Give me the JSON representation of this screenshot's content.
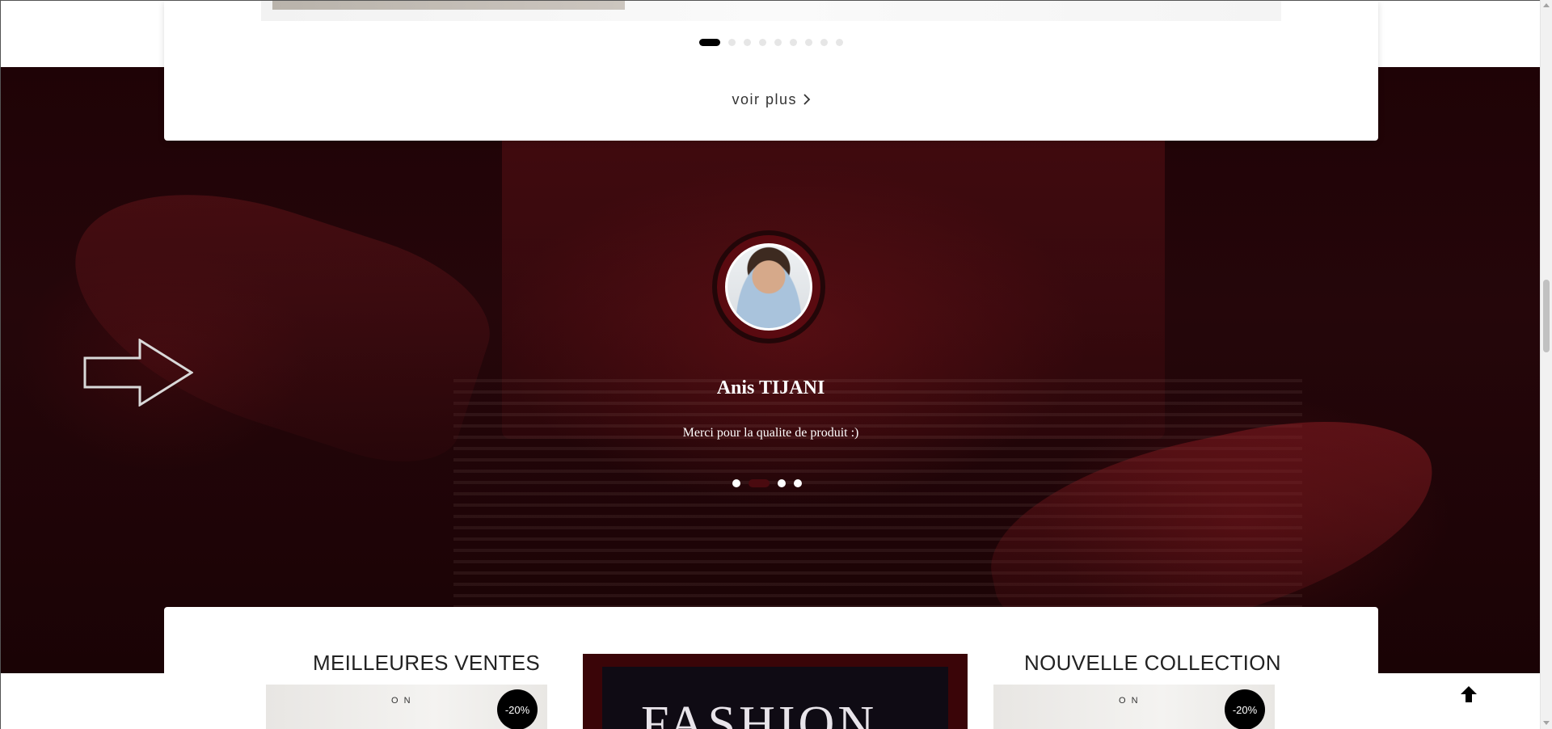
{
  "products_section": {
    "more_link": "voir plus",
    "carousel_dots": 9,
    "carousel_active": 0
  },
  "testimonial": {
    "name": "Anis TIJANI",
    "message": "Merci pour la qualite de produit :)",
    "dots": 4,
    "active_dot": 1,
    "arrow_icon": "outline-arrow-right-icon"
  },
  "collections": {
    "left_title": "MEILLEURES VENTES",
    "right_title": "NOUVELLE COLLECTION",
    "left_badge": "-20%",
    "right_badge": "-20%",
    "left_thumb_text": "O N",
    "right_thumb_text": "O N",
    "banner_word": "FASHION"
  },
  "scroll_top": {
    "icon": "arrow-up-icon"
  },
  "colors": {
    "hero_dark": "#220408",
    "accent": "#4a0a0f",
    "banner_frame": "#3a0508"
  }
}
